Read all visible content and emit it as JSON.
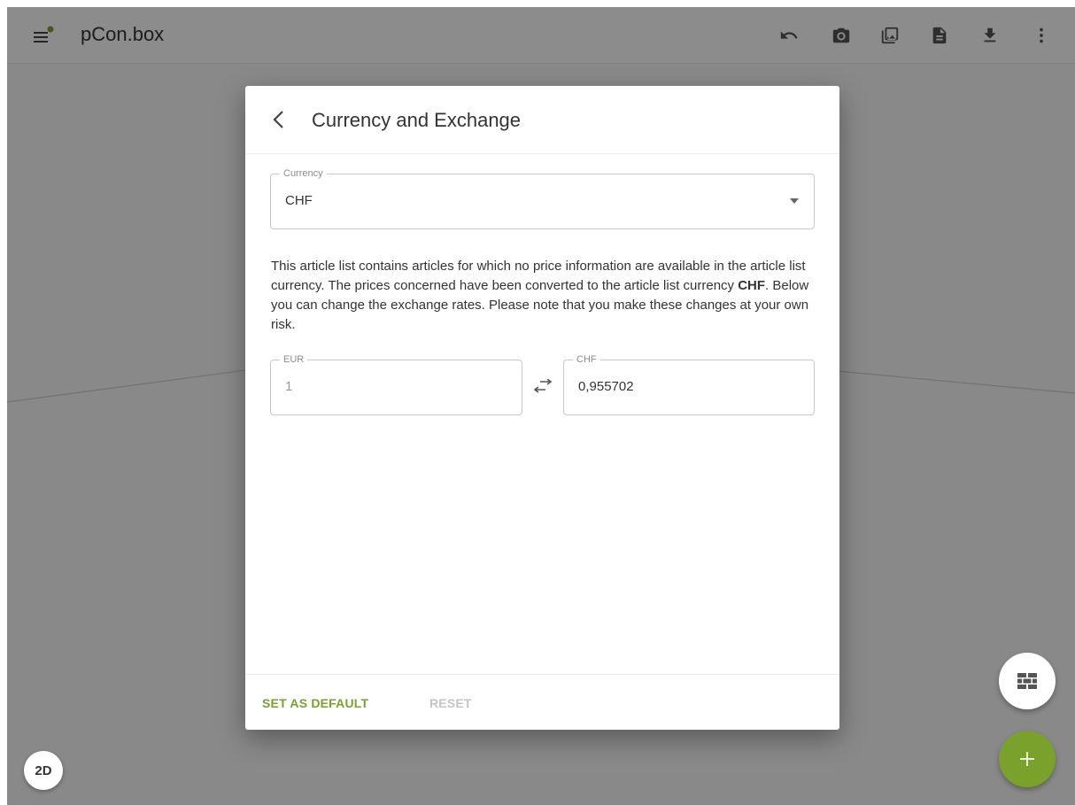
{
  "app": {
    "title": "pCon.box",
    "accent_color": "#7aa12b"
  },
  "toolbar": {
    "icons": [
      "undo-icon",
      "camera-icon",
      "gallery-icon",
      "document-icon",
      "download-icon",
      "more-vert-icon"
    ]
  },
  "view_toggle": {
    "label": "2D"
  },
  "dialog": {
    "title": "Currency and Exchange",
    "currency": {
      "label": "Currency",
      "selected": "CHF"
    },
    "info": {
      "before": "This article list contains articles for which no price information are available in the article list currency. The prices concerned have been converted to the article list currency ",
      "highlight": "CHF",
      "after": ". Below you can change the exchange rates. Please note that you make these changes at your own risk."
    },
    "exchange": {
      "from_label": "EUR",
      "from_value": "1",
      "to_label": "CHF",
      "to_value": "0,955702"
    },
    "footer": {
      "set_default_label": "SET AS DEFAULT",
      "reset_label": "RESET"
    }
  }
}
